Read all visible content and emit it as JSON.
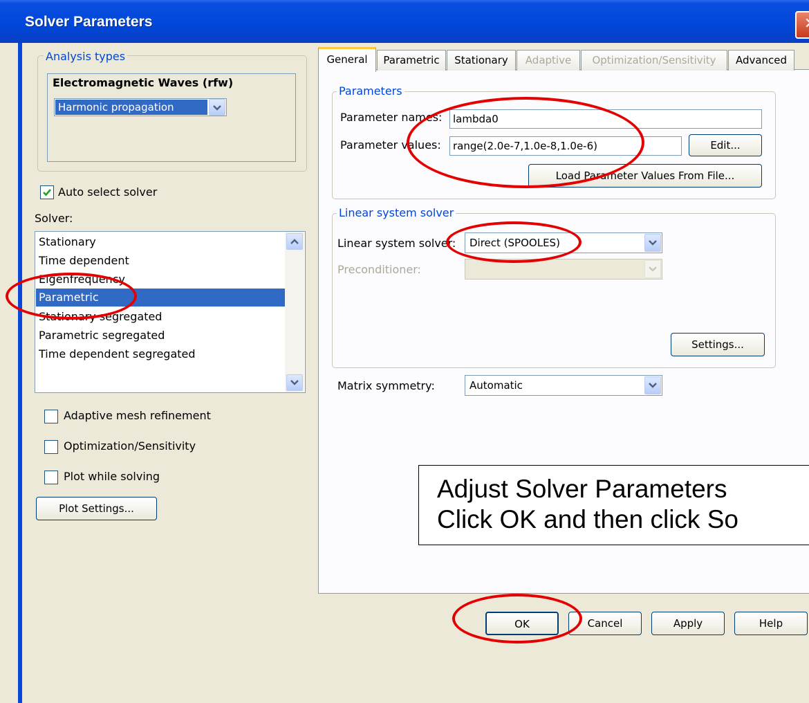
{
  "window": {
    "title": "Solver Parameters",
    "close_glyph": "✕"
  },
  "analysis": {
    "group_label": "Analysis types",
    "app_name": "Electromagnetic Waves (rfw)",
    "selected_type": "Harmonic propagation"
  },
  "auto_select": {
    "label": "Auto select solver",
    "checked": true
  },
  "solver": {
    "label": "Solver:",
    "items": [
      "Stationary",
      "Time dependent",
      "Eigenfrequency",
      "Parametric",
      "Stationary segregated",
      "Parametric segregated",
      "Time dependent segregated"
    ],
    "selected": "Parametric"
  },
  "options": {
    "adaptive": "Adaptive mesh refinement",
    "optimization": "Optimization/Sensitivity",
    "plot_while": "Plot while solving"
  },
  "plot_settings_label": "Plot Settings...",
  "tabs": [
    "General",
    "Parametric",
    "Stationary",
    "Adaptive",
    "Optimization/Sensitivity",
    "Advanced"
  ],
  "active_tab": "General",
  "parameters": {
    "group_label": "Parameters",
    "names_label": "Parameter names:",
    "names_value": "lambda0",
    "values_label": "Parameter values:",
    "values_value": "range(2.0e-7,1.0e-8,1.0e-6)",
    "edit_label": "Edit...",
    "load_label": "Load Parameter Values From File..."
  },
  "linear": {
    "group_label": "Linear system solver",
    "solver_label": "Linear system solver:",
    "solver_value": "Direct (SPOOLES)",
    "precond_label": "Preconditioner:",
    "precond_value": "",
    "settings_label": "Settings..."
  },
  "matrix": {
    "label": "Matrix symmetry:",
    "value": "Automatic"
  },
  "callout": {
    "line1": "Adjust Solver Parameters",
    "line2": "Click OK and then click So"
  },
  "buttons": {
    "ok": "OK",
    "cancel": "Cancel",
    "apply": "Apply",
    "help": "Help"
  },
  "colors": {
    "titlebar": "#0047d9",
    "selection": "#316ac5",
    "annotation_red": "#e40000",
    "group_label": "#0046d5"
  }
}
